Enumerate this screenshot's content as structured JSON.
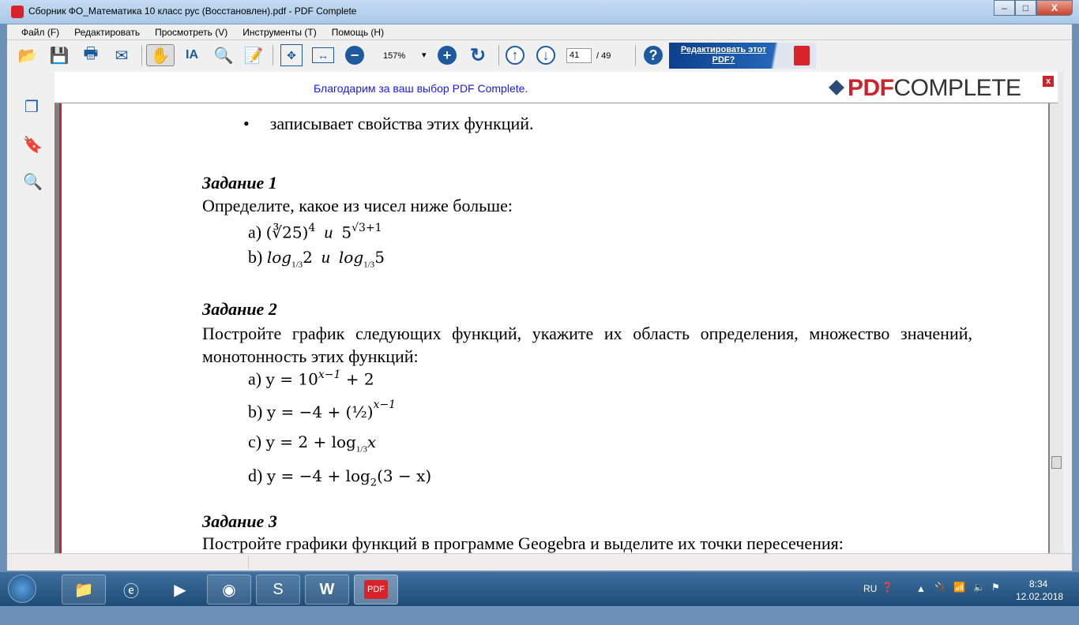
{
  "window": {
    "title": "Сборник ФО_Математика 10 класс рус (Восстановлен).pdf - PDF Complete",
    "minimize": "–",
    "maximize": "□",
    "close": "X"
  },
  "menu": [
    "Файл (F)",
    "Редактировать",
    "Просмотреть (V)",
    "Инструменты (T)",
    "Помощь (H)"
  ],
  "toolbar": {
    "zoom": "157%",
    "zoom_dropdown": "▾",
    "page": "41",
    "page_total": "/ 49",
    "edit_button": "Редактировать этот PDF?",
    "help": "?"
  },
  "banner": {
    "message": "Благодарим за ваш выбор  PDF Complete.",
    "logo_bold": "PDF",
    "logo_rest": "COMPLETE",
    "close": "x"
  },
  "document": {
    "bullet": "записывает свойства этих функций.",
    "task1": {
      "title": "Задание 1",
      "text": "Определите, какое из чисел ниже больше:",
      "a_label": "a)",
      "a_math": "(∛25)",
      "a_exp": "4",
      "a_and": "и",
      "a_base": "5",
      "a_exp2": "√3+1",
      "b_label": "b)",
      "b_log": "log",
      "b_base": "1/3",
      "b_arg1": "2",
      "b_and": "и",
      "b_arg2": "5"
    },
    "task2": {
      "title": "Задание 2",
      "text": "Постройте график следующих функций, укажите их область определения, множество значений, монотонность этих функций:",
      "a_label": "a)",
      "a_math": "y = 10",
      "a_exp": "x−1",
      "a_tail": " + 2",
      "b_label": "b)",
      "b_math": "y = −4 + (½)",
      "b_exp": "x−1",
      "c_label": "c)",
      "c_math": "y = 2 + log",
      "c_base": "1/3",
      "c_tail": "x",
      "d_label": "d)",
      "d_math": "y = −4 + log",
      "d_base": "2",
      "d_tail": "(3 − x)"
    },
    "task3": {
      "title": "Задание 3",
      "text": "Постройте графики функций в программе Geogebra и выделите их точки пересечения:"
    }
  },
  "tray": {
    "lang": "RU",
    "time": "8:34",
    "date": "12.02.2018"
  }
}
